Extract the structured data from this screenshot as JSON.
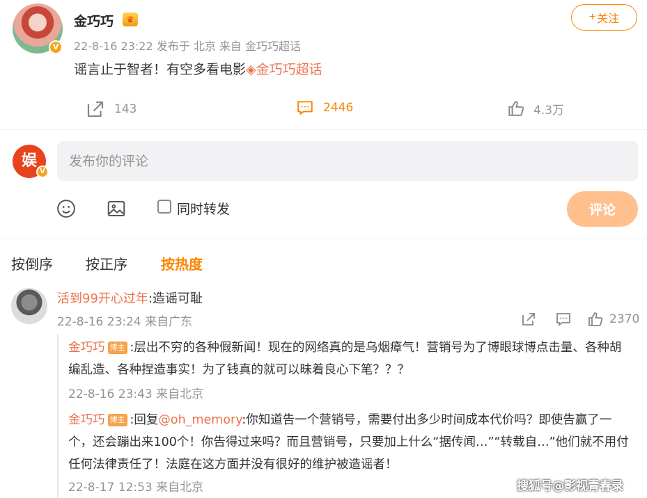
{
  "post": {
    "author_name": "金巧巧",
    "badge_label": "V",
    "crown_label": "冠",
    "follow_label": "关注",
    "follow_plus": "+",
    "meta": "22-8-16 23:22  发布于 北京  来自 金巧巧超话",
    "text": "谣言止于智者！有空多看电影",
    "topic": "金巧巧超话",
    "topic_icon": "◈",
    "repost_count": "143",
    "comment_count": "2446",
    "like_count": "4.3万"
  },
  "composer": {
    "avatar_text": "娱",
    "placeholder": "发布你的评论",
    "repost_label": "同时转发",
    "submit_label": "评论"
  },
  "sort": {
    "tabs": [
      "按倒序",
      "按正序",
      "按热度"
    ],
    "active": "按热度"
  },
  "comment": {
    "author": "活到99开心过年",
    "text": ":造谣可耻",
    "meta": "22-8-16 23:24 来自广东",
    "like_count": "2370",
    "replies": [
      {
        "author": "金巧巧",
        "badge": "博主",
        "text": ":层出不穷的各种假新闻！现在的网络真的是乌烟瘴气！营销号为了博眼球博点击量、各种胡编乱造、各种捏造事实！为了钱真的就可以昧着良心下笔？？？",
        "meta": "22-8-16 23:43 来自北京"
      },
      {
        "author": "金巧巧",
        "badge": "博主",
        "prefix": ":回复",
        "mention": "@oh_memory",
        "text": ":你知道告一个营销号，需要付出多少时间成本代价吗？即使告赢了一个，还会蹦出来100个！你告得过来吗？而且营销号，只要加上什么“据传闻…”“转载自…”他们就不用付任何法律责任了！法庭在这方面并没有很好的维护被造谣者！",
        "meta": "22-8-17 12:53 来自北京"
      }
    ]
  },
  "watermark": "搜狐号@影视青春录",
  "colors": {
    "accent": "#ff8200",
    "link": "#eb7350",
    "muted": "#939393"
  }
}
